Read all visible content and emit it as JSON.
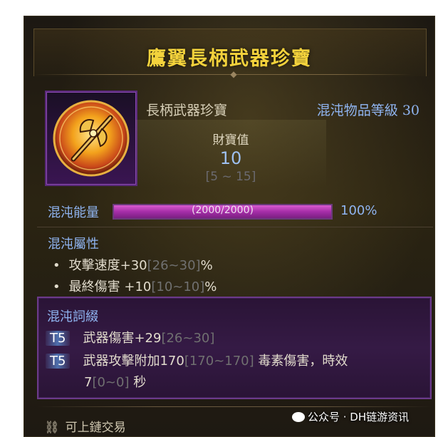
{
  "tooltip": {
    "title": "鷹翼長柄武器珍寶",
    "item_type": "長柄武器珍寶",
    "item_level": "混沌物品等級 30",
    "treasure": {
      "label": "財寶值",
      "value": "10",
      "range": "[5 ~ 15]"
    },
    "chaos_energy": {
      "label": "混沌能量",
      "bar_text": "(2000/2000)",
      "percent_text": "100%",
      "fill_fraction": 1.0
    },
    "chaos_attributes": {
      "title": "混沌屬性",
      "items": [
        {
          "prefix": "攻擊速度+",
          "value": "30",
          "range": "[26~30]",
          "suffix": "%"
        },
        {
          "prefix": "最終傷害 +",
          "value": "10",
          "range": "[10~10]",
          "suffix": "%"
        }
      ]
    },
    "chaos_affixes": {
      "title": "混沌詞綴",
      "items": [
        {
          "tier": "T5",
          "text": "武器傷害+",
          "value": "29",
          "range": "[26~30]",
          "suffix": ""
        },
        {
          "tier": "T5",
          "text": "武器攻擊附加",
          "value": "170",
          "range": "[170~170]",
          "suffix": " 毒素傷害，時效",
          "line2_value": "7",
          "line2_range": "[0~0]",
          "line2_suffix": " 秒"
        }
      ]
    },
    "trade_label": "可上鏈交易",
    "watermark": "公众号 · DH链游资讯"
  },
  "colors": {
    "title": "#f3d23c",
    "accent_blue": "#8fb4f0",
    "bar_fill": "#a52ea8",
    "range_grey": "#707070"
  },
  "icons": {
    "item": "golden-axe-orb-icon",
    "trade": "chain-link-icon"
  }
}
